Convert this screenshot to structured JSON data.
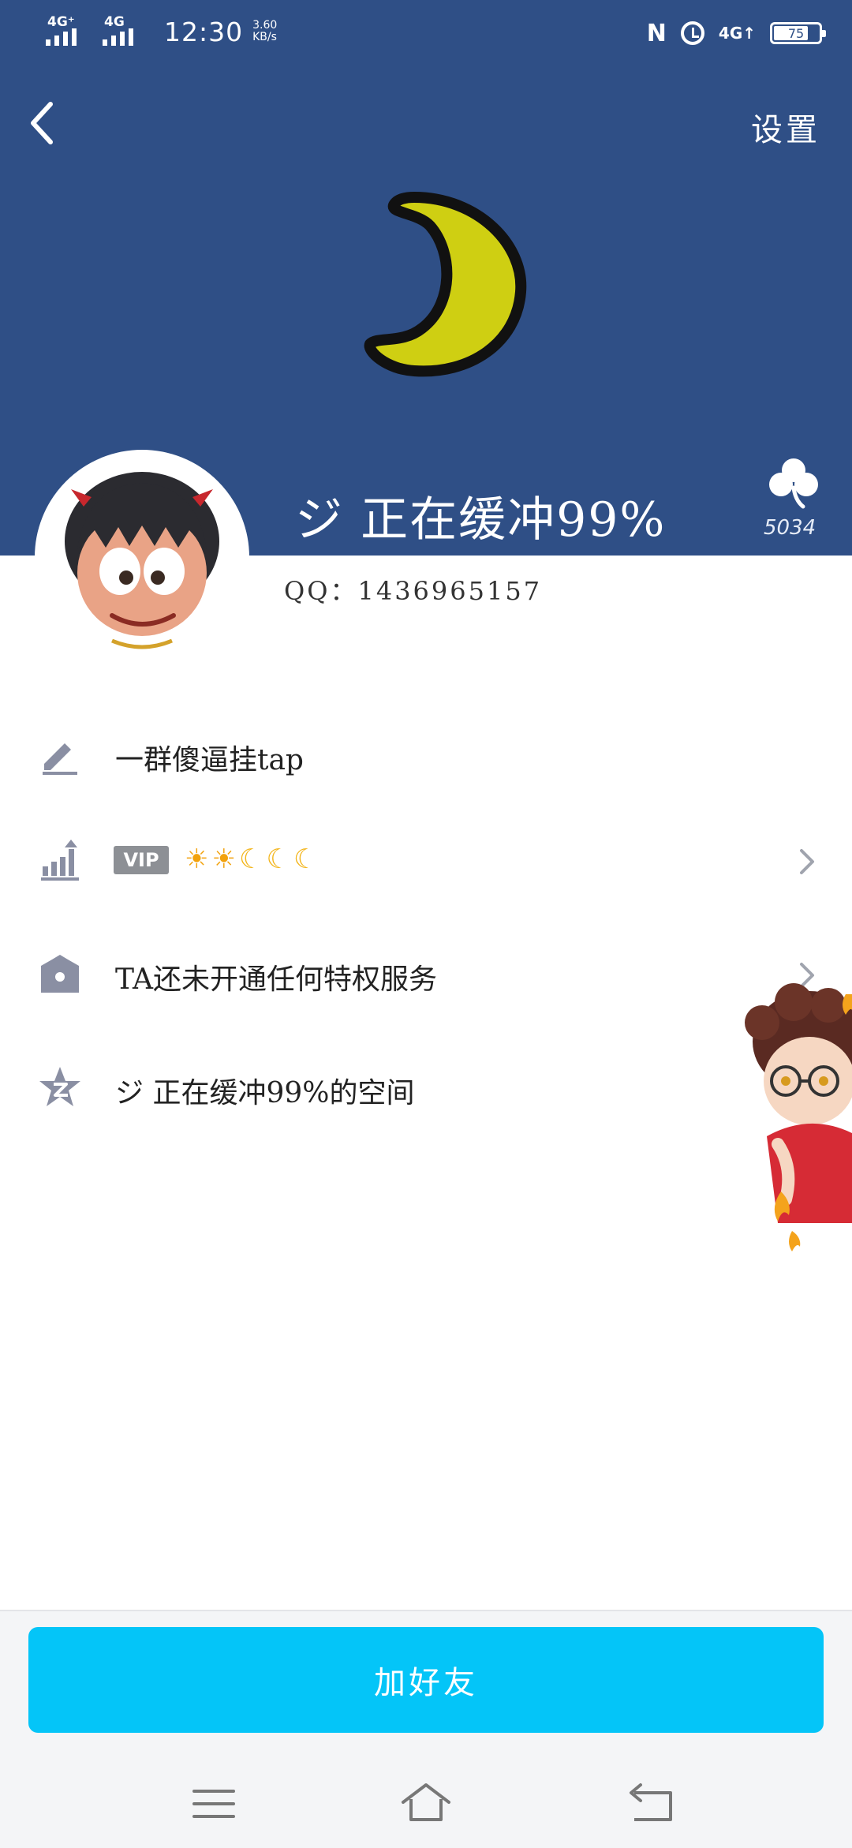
{
  "status_bar": {
    "network_left_1": "4G⁺",
    "network_left_2": "4G",
    "time": "12:30",
    "speed_value": "3.60",
    "speed_unit": "KB/s",
    "nfc": "N",
    "network_right": "4G↑",
    "battery": "75"
  },
  "header": {
    "settings_label": "设置",
    "nickname": "ジ 正在缓冲99%",
    "clover_count": "5034"
  },
  "profile": {
    "qq_text": "QQ：1436965157"
  },
  "rows": {
    "signature": "一群傻逼挂tap",
    "vip_label": "VIP",
    "privilege": "TA还未开通任何特权服务",
    "space": "ジ 正在缓冲99%的空间"
  },
  "icons": {
    "level_suns": 2,
    "level_moons": 3
  },
  "footer": {
    "add_friend_label": "加好友"
  },
  "colors": {
    "header_bg": "#2f4f86",
    "button_bg": "#04c5f8",
    "icon_gray": "#8a8fa3"
  }
}
